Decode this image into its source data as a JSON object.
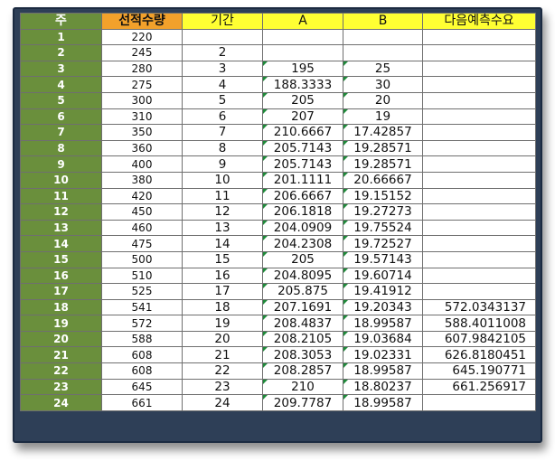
{
  "headers": [
    "주",
    "선적수량",
    "기간",
    "A",
    "B",
    "다음예측수요"
  ],
  "rows": [
    {
      "week": "1",
      "qty": "220",
      "period": "",
      "a": "",
      "b": "",
      "forecast": ""
    },
    {
      "week": "2",
      "qty": "245",
      "period": "2",
      "a": "",
      "b": "",
      "forecast": ""
    },
    {
      "week": "3",
      "qty": "280",
      "period": "3",
      "a": "195",
      "b": "25",
      "forecast": ""
    },
    {
      "week": "4",
      "qty": "275",
      "period": "4",
      "a": "188.3333",
      "b": "30",
      "forecast": ""
    },
    {
      "week": "5",
      "qty": "300",
      "period": "5",
      "a": "205",
      "b": "20",
      "forecast": ""
    },
    {
      "week": "6",
      "qty": "310",
      "period": "6",
      "a": "207",
      "b": "19",
      "forecast": ""
    },
    {
      "week": "7",
      "qty": "350",
      "period": "7",
      "a": "210.6667",
      "b": "17.42857",
      "forecast": ""
    },
    {
      "week": "8",
      "qty": "360",
      "period": "8",
      "a": "205.7143",
      "b": "19.28571",
      "forecast": ""
    },
    {
      "week": "9",
      "qty": "400",
      "period": "9",
      "a": "205.7143",
      "b": "19.28571",
      "forecast": ""
    },
    {
      "week": "10",
      "qty": "380",
      "period": "10",
      "a": "201.1111",
      "b": "20.66667",
      "forecast": ""
    },
    {
      "week": "11",
      "qty": "420",
      "period": "11",
      "a": "206.6667",
      "b": "19.15152",
      "forecast": ""
    },
    {
      "week": "12",
      "qty": "450",
      "period": "12",
      "a": "206.1818",
      "b": "19.27273",
      "forecast": ""
    },
    {
      "week": "13",
      "qty": "460",
      "period": "13",
      "a": "204.0909",
      "b": "19.75524",
      "forecast": ""
    },
    {
      "week": "14",
      "qty": "475",
      "period": "14",
      "a": "204.2308",
      "b": "19.72527",
      "forecast": ""
    },
    {
      "week": "15",
      "qty": "500",
      "period": "15",
      "a": "205",
      "b": "19.57143",
      "forecast": ""
    },
    {
      "week": "16",
      "qty": "510",
      "period": "16",
      "a": "204.8095",
      "b": "19.60714",
      "forecast": ""
    },
    {
      "week": "17",
      "qty": "525",
      "period": "17",
      "a": "205.875",
      "b": "19.41912",
      "forecast": ""
    },
    {
      "week": "18",
      "qty": "541",
      "period": "18",
      "a": "207.1691",
      "b": "19.20343",
      "forecast": "572.0343137"
    },
    {
      "week": "19",
      "qty": "572",
      "period": "19",
      "a": "208.4837",
      "b": "18.99587",
      "forecast": "588.4011008"
    },
    {
      "week": "20",
      "qty": "588",
      "period": "20",
      "a": "208.2105",
      "b": "19.03684",
      "forecast": "607.9842105"
    },
    {
      "week": "21",
      "qty": "608",
      "period": "21",
      "a": "208.3053",
      "b": "19.02331",
      "forecast": "626.8180451"
    },
    {
      "week": "22",
      "qty": "608",
      "period": "22",
      "a": "208.2857",
      "b": "18.99587",
      "forecast": "645.190771"
    },
    {
      "week": "23",
      "qty": "645",
      "period": "23",
      "a": "210",
      "b": "18.80237",
      "forecast": "661.256917"
    },
    {
      "week": "24",
      "qty": "661",
      "period": "24",
      "a": "209.7787",
      "b": "18.99587",
      "forecast": ""
    }
  ],
  "colors": {
    "frame": "#2e3f57",
    "week_column": "#6a8f3c",
    "sales_header": "#f2a12b",
    "yellow_header": "#ffff33",
    "error_marker": "#1f8a3a"
  }
}
